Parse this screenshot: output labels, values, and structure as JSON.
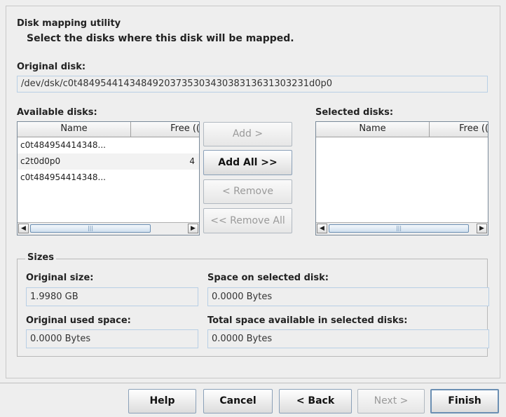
{
  "dialog": {
    "title": "Disk mapping utility",
    "subtitle": "Select the disks where this disk will be mapped."
  },
  "original_disk": {
    "label": "Original disk:",
    "value": "/dev/dsk/c0t4849544143484920373530343038313631303231d0p0"
  },
  "available": {
    "label": "Available disks:",
    "columns": [
      "Name",
      "Free (("
    ],
    "rows": [
      {
        "name": "c0t484954414348...",
        "free": ""
      },
      {
        "name": "c2t0d0p0",
        "free": "4"
      },
      {
        "name": "c0t484954414348...",
        "free": ""
      }
    ]
  },
  "selected": {
    "label": "Selected disks:",
    "columns": [
      "Name",
      "Free (("
    ]
  },
  "transfer": {
    "add": "Add >",
    "add_all": "Add All >>",
    "remove": "< Remove",
    "remove_all": "<< Remove All"
  },
  "sizes": {
    "title": "Sizes",
    "original_size_label": "Original size:",
    "original_size_value": "1.9980 GB",
    "space_selected_label": "Space on selected disk:",
    "space_selected_value": "0.0000 Bytes",
    "original_used_label": "Original used space:",
    "original_used_value": "0.0000 Bytes",
    "total_available_label": "Total space available in selected disks:",
    "total_available_value": "0.0000 Bytes"
  },
  "footer": {
    "help": "Help",
    "cancel": "Cancel",
    "back": "< Back",
    "next": "Next >",
    "finish": "Finish"
  }
}
